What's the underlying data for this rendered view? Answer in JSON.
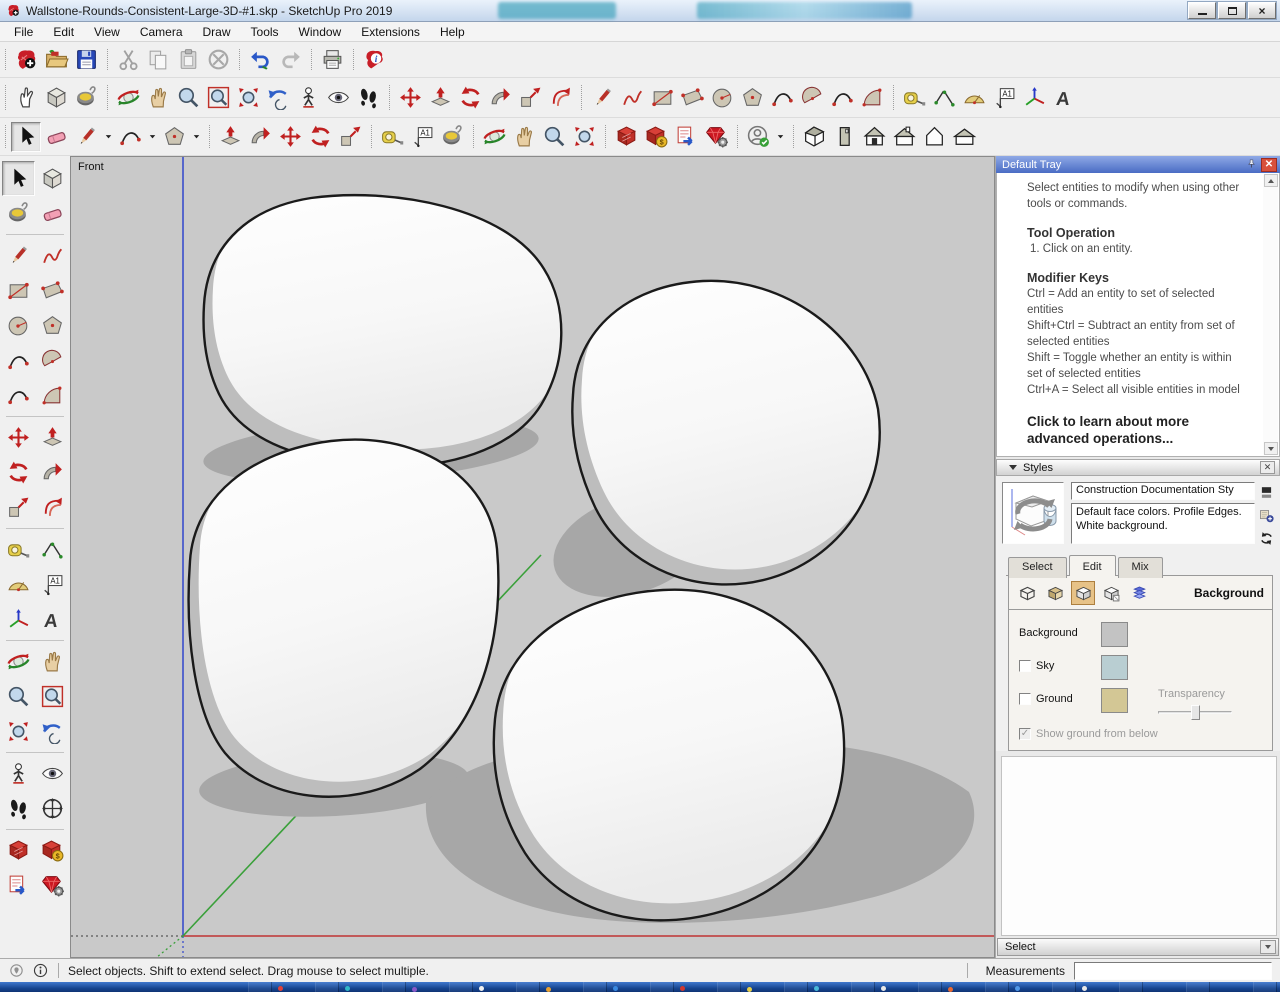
{
  "window": {
    "title": "Wallstone-Rounds-Consistent-Large-3D-#1.skp - SketchUp Pro 2019"
  },
  "menu": {
    "items": [
      "File",
      "Edit",
      "View",
      "Camera",
      "Draw",
      "Tools",
      "Window",
      "Extensions",
      "Help"
    ]
  },
  "toolbars": {
    "row1": [
      [
        "new-document",
        "open",
        "save"
      ],
      [
        "cut",
        "copy",
        "paste",
        "erase"
      ],
      [
        "undo",
        "redo"
      ],
      [
        "print"
      ],
      [
        "model-info"
      ]
    ],
    "row2": [
      [
        "pointer-hand",
        "make-component",
        "paint-bucket"
      ],
      [
        "orbit",
        "pan",
        "zoom",
        "zoom-window",
        "zoom-extents",
        "previous-view",
        "position-camera",
        "look-around",
        "walk"
      ],
      [
        "move",
        "push-pull",
        "rotate",
        "follow-me",
        "scale",
        "offset"
      ],
      [
        "line",
        "freehand",
        "rectangle",
        "rotated-rectangle",
        "circle",
        "polygon",
        "arc-2pt",
        "pie",
        "arc-3pt",
        "arc-filled"
      ],
      [
        "tape-measure",
        "dimension",
        "protractor",
        "text",
        "axes",
        "3d-text"
      ]
    ],
    "row3": [
      [
        "select",
        "eraser",
        "line",
        "arc-2pt",
        "polygon"
      ],
      [
        "push-pull",
        "follow-me",
        "move",
        "rotate",
        "scale"
      ],
      [
        "tape-measure",
        "text",
        "paint-bucket"
      ],
      [
        "orbit",
        "pan",
        "zoom",
        "zoom-extents"
      ],
      [
        "3d-warehouse",
        "extension-warehouse",
        "share-model",
        "extension-manager"
      ],
      [
        "account"
      ],
      [
        "views-iso",
        "views-top",
        "views-front",
        "views-back",
        "views-left",
        "views-right"
      ]
    ],
    "row3_dropdown_tools": [
      "line",
      "arc-2pt",
      "polygon",
      "account"
    ],
    "active_tool": "select"
  },
  "large_tool_set": {
    "rows": [
      [
        "select",
        "make-component"
      ],
      [
        "paint-bucket",
        "eraser"
      ],
      [
        "line",
        "freehand"
      ],
      [
        "rectangle",
        "rotated-rectangle"
      ],
      [
        "circle",
        "polygon"
      ],
      [
        "arc-2pt",
        "pie"
      ],
      [
        "arc-3pt",
        "arc-filled"
      ],
      [
        "move",
        "push-pull"
      ],
      [
        "rotate",
        "follow-me"
      ],
      [
        "scale",
        "offset"
      ],
      [
        "tape-measure",
        "dimension"
      ],
      [
        "protractor",
        "text"
      ],
      [
        "axes",
        "3d-text"
      ],
      [
        "orbit",
        "pan"
      ],
      [
        "zoom",
        "zoom-window"
      ],
      [
        "zoom-extents",
        "previous-view"
      ],
      [
        "position-camera",
        "look-around"
      ],
      [
        "walk",
        "navigation-circle"
      ],
      [
        "3d-warehouse",
        "extension-warehouse"
      ],
      [
        "share-model",
        "extension-manager"
      ]
    ]
  },
  "viewport": {
    "view_label": "Front"
  },
  "tray": {
    "title": "Default Tray",
    "instructor": {
      "intro": "Select entities to modify when using other tools or commands.",
      "tool_operation_title": "Tool Operation",
      "tool_operation_steps": [
        "1. Click on an entity."
      ],
      "modifier_keys_title": "Modifier Keys",
      "modifier_lines": [
        "Ctrl = Add an entity to set of selected entities",
        "Shift+Ctrl = Subtract an entity from set of selected entities",
        "Shift = Toggle whether an entity is within set of selected entities",
        "Ctrl+A = Select all visible entities in model"
      ],
      "learn_more": "Click to learn about more advanced operations..."
    },
    "styles": {
      "header": "Styles",
      "style_name": "Construction Documentation Sty",
      "style_description": "Default face colors. Profile Edges. White background.",
      "tabs": [
        "Select",
        "Edit",
        "Mix"
      ],
      "active_tab": "Edit",
      "edit_icons": [
        "edge-settings",
        "face-settings",
        "background-settings",
        "watermark-settings",
        "modeling-settings"
      ],
      "active_edit_icon": "background-settings",
      "section_title": "Background",
      "rows": {
        "background_label": "Background",
        "sky_label": "Sky",
        "ground_label": "Ground",
        "transparency_label": "Transparency",
        "show_ground_label": "Show ground from below"
      },
      "checkbox_states": {
        "sky": false,
        "ground": false,
        "show_ground_from_below": true
      },
      "swatches": {
        "background": "#c3c3c3",
        "sky": "#b9ced2",
        "ground": "#d3c795"
      }
    },
    "collapsed_panel": "Select"
  },
  "status_bar": {
    "hint": "Select objects. Shift to extend select. Drag mouse to select multiple.",
    "measurements_label": "Measurements",
    "measurements_value": ""
  },
  "colors": {
    "viewport_bg": "#c9c9c9",
    "axis_red": "#c03434",
    "axis_green": "#3aa03a",
    "axis_blue": "#3a4ecc",
    "tray_header": "#4a6cc4",
    "taskbar": "#16448e"
  }
}
